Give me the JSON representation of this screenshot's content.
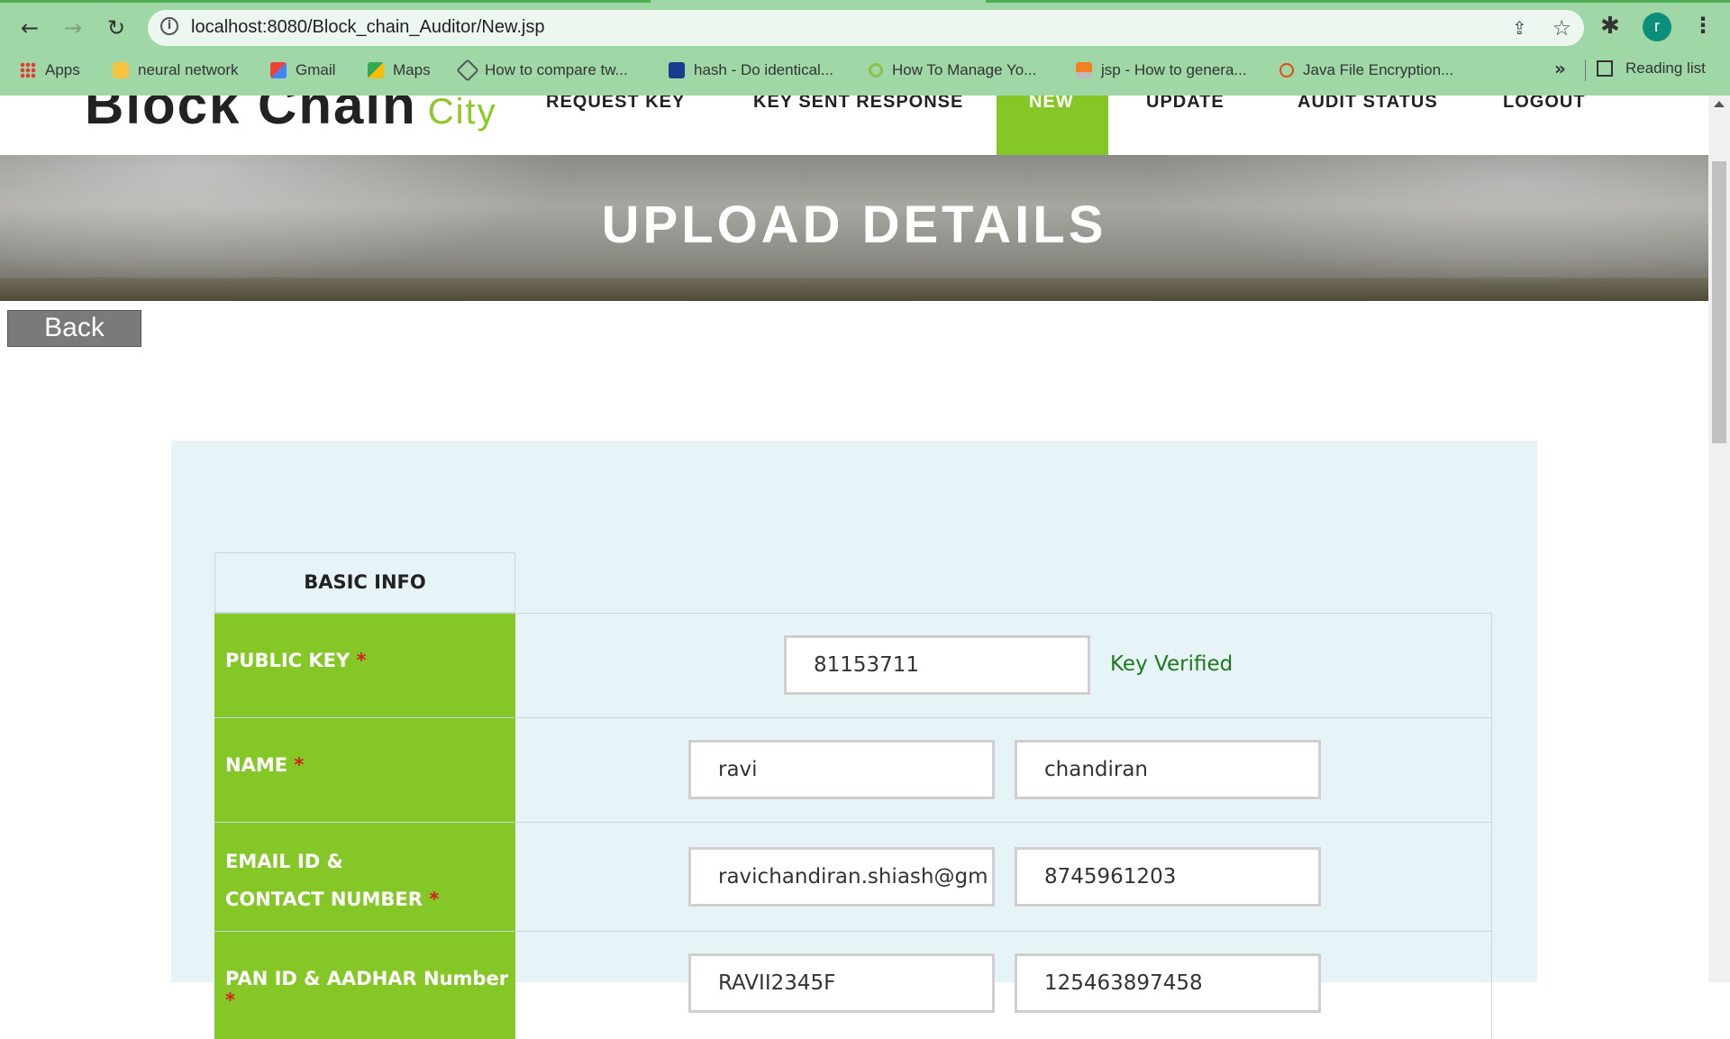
{
  "browser": {
    "url": "localhost:8080/Block_chain_Auditor/New.jsp",
    "avatar_letter": "r",
    "bookmarks": [
      {
        "label": "Apps",
        "icon": "apps-grid-icon"
      },
      {
        "label": "neural network",
        "icon": "folder-icon"
      },
      {
        "label": "Gmail",
        "icon": "gmail-icon"
      },
      {
        "label": "Maps",
        "icon": "maps-icon"
      },
      {
        "label": "How to compare tw...",
        "icon": "site-icon"
      },
      {
        "label": "hash - Do identical...",
        "icon": "site-icon"
      },
      {
        "label": "How To Manage Yo...",
        "icon": "site-icon"
      },
      {
        "label": "jsp - How to genera...",
        "icon": "stackoverflow-icon"
      },
      {
        "label": "Java File Encryption...",
        "icon": "site-icon"
      }
    ],
    "reading_list": "Reading list",
    "more": "»"
  },
  "site": {
    "logo_main": "Block Chain",
    "logo_sub": "City",
    "nav": [
      {
        "label": "REQUEST KEY"
      },
      {
        "label": "KEY SENT RESPONSE"
      },
      {
        "label": "NEW",
        "active": true
      },
      {
        "label": "UPDATE"
      },
      {
        "label": "AUDIT STATUS"
      },
      {
        "label": "LOGOUT"
      }
    ],
    "active_color": "#86c728"
  },
  "banner": {
    "title": "UPLOAD DETAILS"
  },
  "back_button": "Back",
  "form": {
    "section_header": "BASIC INFO",
    "required_mark": "*",
    "rows": {
      "public_key": {
        "label": "PUBLIC KEY",
        "value": "81153711",
        "status": "Key Verified"
      },
      "name": {
        "label": "NAME",
        "first": "ravi",
        "last": "chandiran"
      },
      "email_contact": {
        "label_line1": "EMAIL ID &",
        "label_line2": "CONTACT NUMBER",
        "email": "ravichandiran.shiash@gm",
        "phone": "8745961203"
      },
      "pan_aadhar": {
        "label": "PAN ID & AADHAR Number",
        "pan": "RAVII2345F",
        "aadhar": "125463897458"
      }
    },
    "label_color": "#86c728",
    "panel_color": "#e6f3f7"
  }
}
